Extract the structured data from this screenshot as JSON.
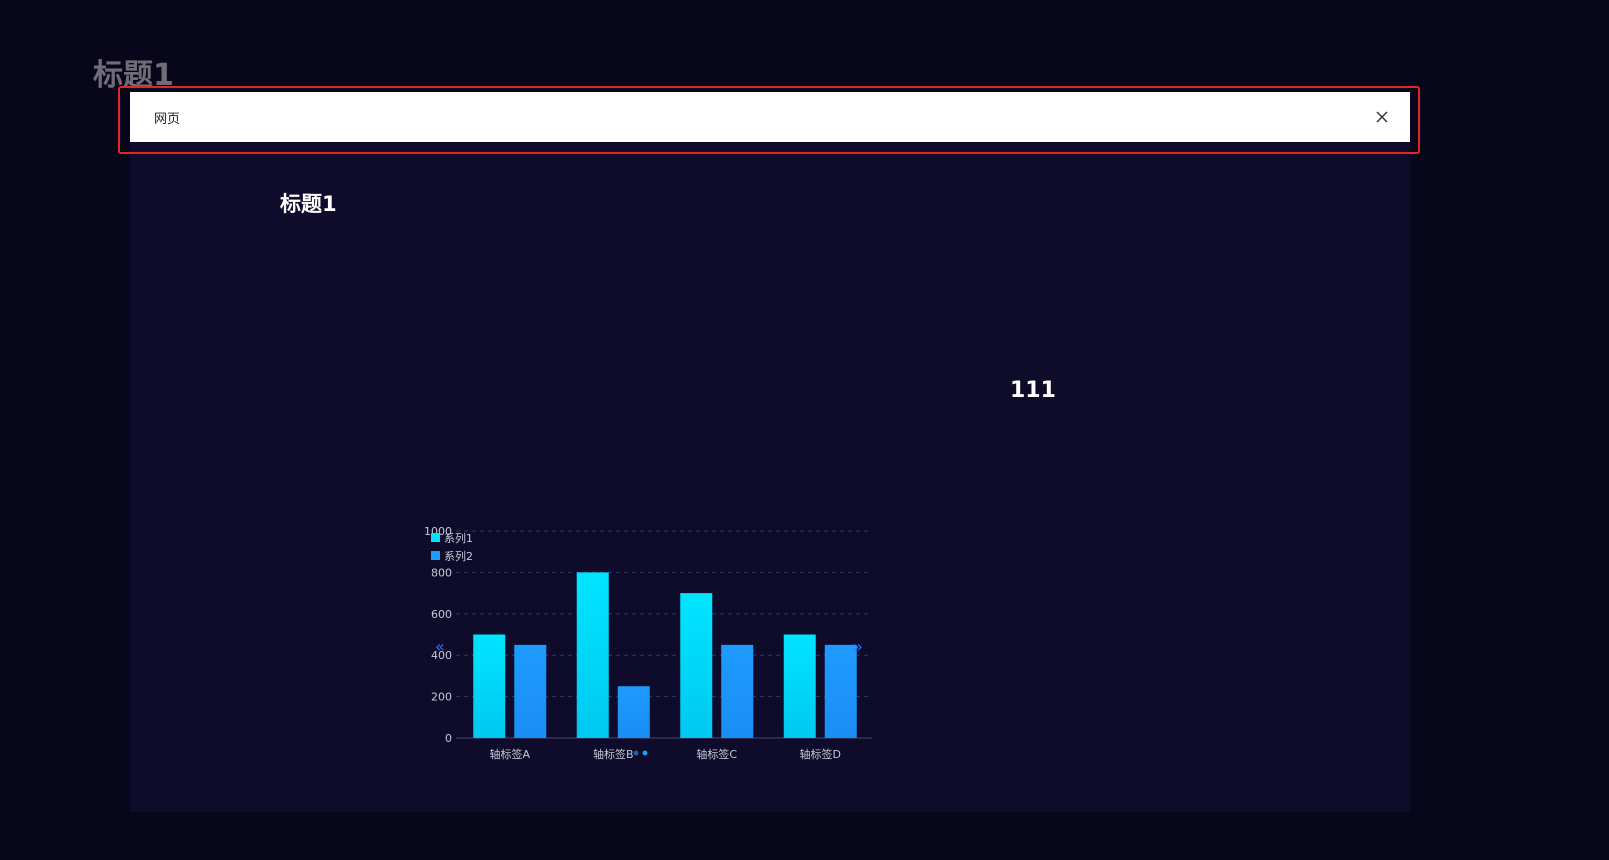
{
  "background": {
    "title": "标题1"
  },
  "modal": {
    "header_title": "网页",
    "close_label": "X",
    "inner_title": "标题1",
    "number_text": "111"
  },
  "colors": {
    "series1": "#00e5ff",
    "series2": "#1e9bff",
    "highlight_border": "#e12828"
  },
  "chart_data": {
    "type": "bar",
    "categories": [
      "轴标签A",
      "轴标签B",
      "轴标签C",
      "轴标签D"
    ],
    "series": [
      {
        "name": "系列1",
        "values": [
          500,
          800,
          700,
          500
        ]
      },
      {
        "name": "系列2",
        "values": [
          450,
          250,
          450,
          450
        ]
      }
    ],
    "ylim": [
      0,
      1000
    ],
    "yticks": [
      0,
      200,
      400,
      600,
      800,
      1000
    ],
    "grid": true,
    "legend": "top-left",
    "nav_prev_icon": "double-chevron-left-icon",
    "nav_next_icon": "double-chevron-right-icon"
  }
}
